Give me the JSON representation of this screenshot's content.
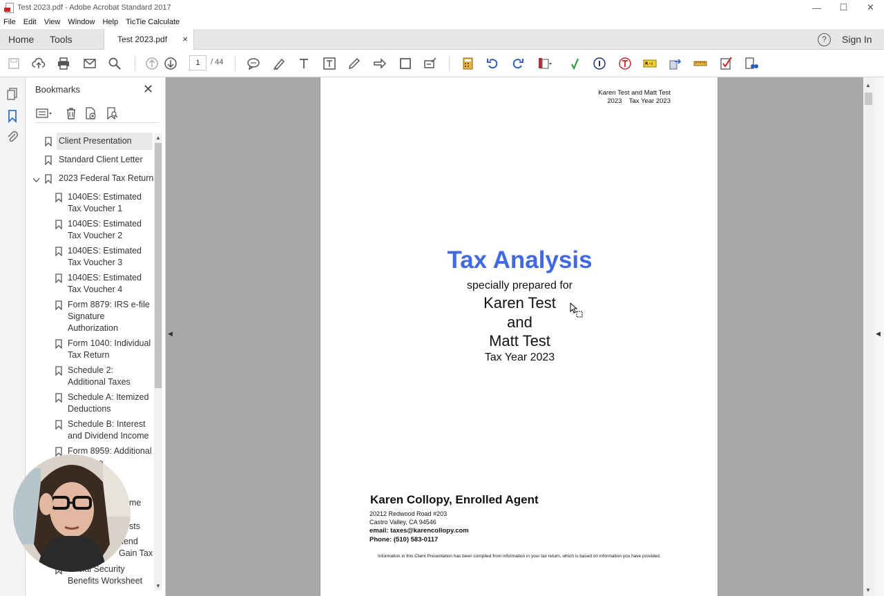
{
  "window": {
    "title": "Test 2023.pdf - Adobe Acrobat Standard 2017",
    "controls": {
      "minimize": "—",
      "maximize": "☐",
      "close": "✕"
    }
  },
  "menu": {
    "items": [
      "File",
      "Edit",
      "View",
      "Window",
      "Help",
      "TicTie Calculate"
    ]
  },
  "tabs": {
    "home": "Home",
    "tools": "Tools",
    "document": "Test 2023.pdf",
    "close": "×",
    "help": "?",
    "signin": "Sign In"
  },
  "toolbar": {
    "page_current": "1",
    "page_total": "/ 44"
  },
  "bookmarks": {
    "header": "Bookmarks",
    "close": "✕",
    "items": [
      {
        "label": "Client Presentation",
        "level": 0,
        "selected": true
      },
      {
        "label": "Standard Client Letter",
        "level": 0
      },
      {
        "label": "2023 Federal Tax Return",
        "level": 0,
        "expanded": true
      },
      {
        "label": "1040ES: Estimated Tax Voucher 1",
        "level": 1
      },
      {
        "label": "1040ES: Estimated Tax Voucher 2",
        "level": 1
      },
      {
        "label": "1040ES: Estimated Tax Voucher 3",
        "level": 1
      },
      {
        "label": "1040ES: Estimated Tax Voucher 4",
        "level": 1
      },
      {
        "label": "Form 8879: IRS e-file Signature Authorization",
        "level": 1
      },
      {
        "label": "Form 1040: Individual Tax Return",
        "level": 1
      },
      {
        "label": "Schedule 2: Additional Taxes",
        "level": 1
      },
      {
        "label": "Schedule A: Itemized Deductions",
        "level": 1
      },
      {
        "label": "Schedule B: Interest and Dividend Income",
        "level": 1
      },
      {
        "label": "Form 8959: Additional Medicare",
        "level": 1
      },
      {
        "label": "me",
        "level": 1
      },
      {
        "label": "sts",
        "level": 1
      },
      {
        "label": "dend Gain Tax",
        "level": 1
      },
      {
        "label": "Social Security Benefits Worksheet",
        "level": 1
      }
    ]
  },
  "page": {
    "header_names": "Karen Test and Matt Test",
    "header_year": "2023    Tax Year 2023",
    "title": "Tax Analysis",
    "subtitle": "specially prepared for",
    "name1": "Karen Test",
    "and": "and",
    "name2": "Matt Test",
    "tax_year": "Tax Year 2023",
    "agent": "Karen Collopy, Enrolled Agent",
    "address1": "20212 Redwood Road #203",
    "address2": "Castro Valley, CA 94546",
    "email": "email: taxes@karencollopy.com",
    "phone": "Phone: (510) 583-0117",
    "note": "Information in this Client Presentation has been compiled from information in your tax return, which is based on information you have provided."
  },
  "colors": {
    "title_blue": "#4169e1",
    "doc_bg": "#a8a8a8",
    "tab_bar": "#e6e6e6"
  }
}
